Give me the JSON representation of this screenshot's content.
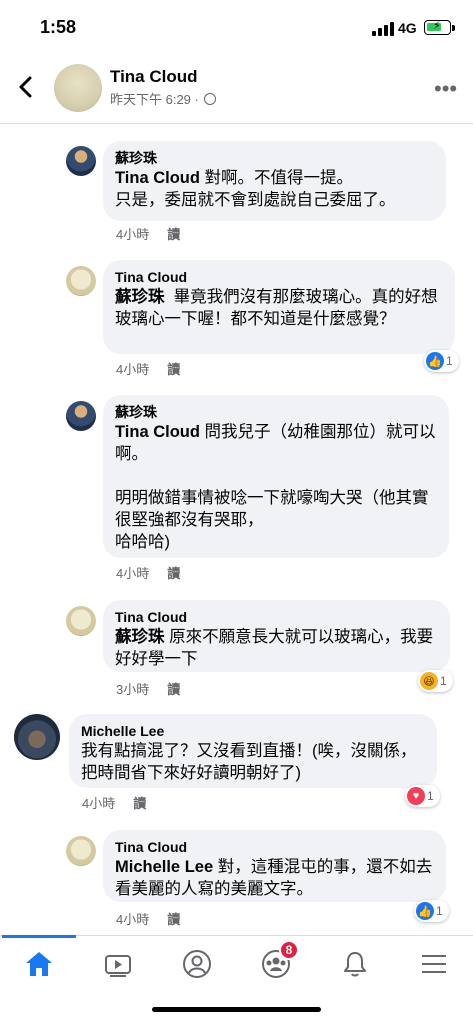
{
  "status": {
    "time": "1:58",
    "network": "4G"
  },
  "header": {
    "name": "Tina Cloud",
    "timestamp": "昨天下午 6:29 ·"
  },
  "comments": [
    {
      "author": "蘇珍珠",
      "mention": "Tina Cloud",
      "text": " 對啊。不值得一提。\n只是，委屈就不會到處說自己委屈了。",
      "time": "4小時",
      "reply": "讀"
    },
    {
      "author": "Tina Cloud",
      "mention": "蘇珍珠",
      "text": "  畢竟我們沒有那麼玻璃心。真的好想玻璃心一下喔！都不知道是什麼感覺？",
      "time": "4小時",
      "reply": "讀",
      "reaction": {
        "icon": "like-icon",
        "count": "1"
      }
    },
    {
      "author": "蘇珍珠",
      "mention": "Tina Cloud",
      "text": " 問我兒子（幼稚園那位）就可以啊。\n\n明明做錯事情被唸一下就嚎啕大哭（他其實很堅強都沒有哭耶，\n哈哈哈)",
      "time": "4小時",
      "reply": "讀"
    },
    {
      "author": "Tina Cloud",
      "mention": "蘇珍珠",
      "text": " 原來不願意長大就可以玻璃心，我要好好學一下",
      "time": "3小時",
      "reply": "讀",
      "reaction": {
        "icon": "haha-icon",
        "count": "1"
      }
    },
    {
      "author": "Michelle Lee",
      "mention": "",
      "text": "我有點搞混了？又沒看到直播！(唉，沒關係，把時間省下來好好讀明朝好了)",
      "time": "4小時",
      "reply": "讀",
      "reaction": {
        "icon": "love-icon",
        "count": "1"
      }
    },
    {
      "author": "Tina Cloud",
      "mention": "Michelle Lee",
      "text": " 對，這種混屯的事，還不如去看美麗的人寫的美麗文字。",
      "time": "4小時",
      "reply": "讀",
      "reaction": {
        "icon": "like-icon",
        "count": "1"
      }
    }
  ],
  "nav": {
    "groups_badge": "8"
  },
  "colors": {
    "accent": "#1877f2",
    "bubble": "#f0f2f5",
    "badge": "#e41e3f"
  }
}
